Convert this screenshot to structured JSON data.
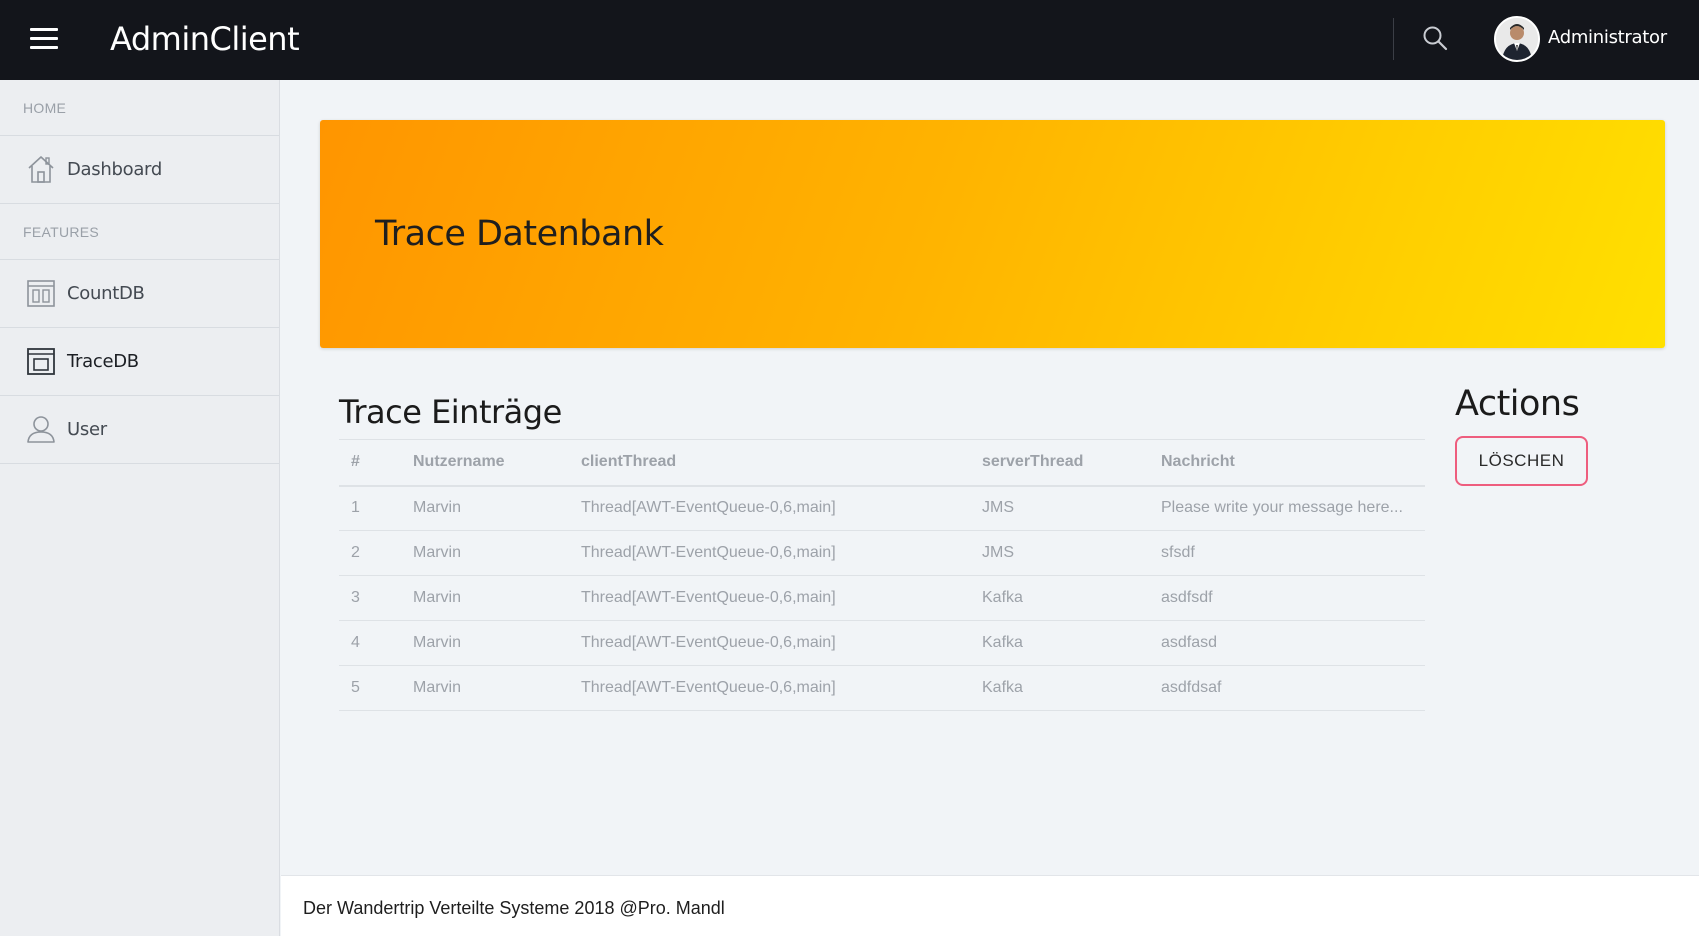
{
  "header": {
    "app_title": "AdminClient",
    "user_name": "Administrator",
    "menu_icon": "hamburger-icon",
    "search_icon": "search-icon"
  },
  "sidebar": {
    "sections": [
      {
        "label": "HOME",
        "items": [
          {
            "label": "Dashboard",
            "icon": "home-icon",
            "active": false
          }
        ]
      },
      {
        "label": "FEATURES",
        "items": [
          {
            "label": "CountDB",
            "icon": "columns-icon",
            "active": false
          },
          {
            "label": "TraceDB",
            "icon": "window-icon",
            "active": true
          },
          {
            "label": "User",
            "icon": "user-icon",
            "active": false
          }
        ]
      }
    ]
  },
  "banner": {
    "title": "Trace Datenbank",
    "gradient_start": "#ff9500",
    "gradient_end": "#ffe000"
  },
  "main": {
    "section_title": "Trace Einträge",
    "table": {
      "headers": [
        "#",
        "Nutzername",
        "clientThread",
        "serverThread",
        "Nachricht"
      ],
      "rows": [
        [
          "1",
          "Marvin",
          "Thread[AWT-EventQueue-0,6,main]",
          "JMS",
          "Please write your message here..."
        ],
        [
          "2",
          "Marvin",
          "Thread[AWT-EventQueue-0,6,main]",
          "JMS",
          "sfsdf"
        ],
        [
          "3",
          "Marvin",
          "Thread[AWT-EventQueue-0,6,main]",
          "Kafka",
          "asdfsdf"
        ],
        [
          "4",
          "Marvin",
          "Thread[AWT-EventQueue-0,6,main]",
          "Kafka",
          "asdfasd"
        ],
        [
          "5",
          "Marvin",
          "Thread[AWT-EventQueue-0,6,main]",
          "Kafka",
          "asdfdsaf"
        ]
      ]
    }
  },
  "actions": {
    "title": "Actions",
    "delete_label": "LÖSCHEN",
    "delete_border_color": "#ee5d7e"
  },
  "footer": {
    "text": "Der Wandertrip Verteilte Systeme 2018 @Pro. Mandl"
  },
  "colors": {
    "topbar": "#13151b",
    "sidebar": "#eceef1",
    "content": "#f1f4f7"
  }
}
